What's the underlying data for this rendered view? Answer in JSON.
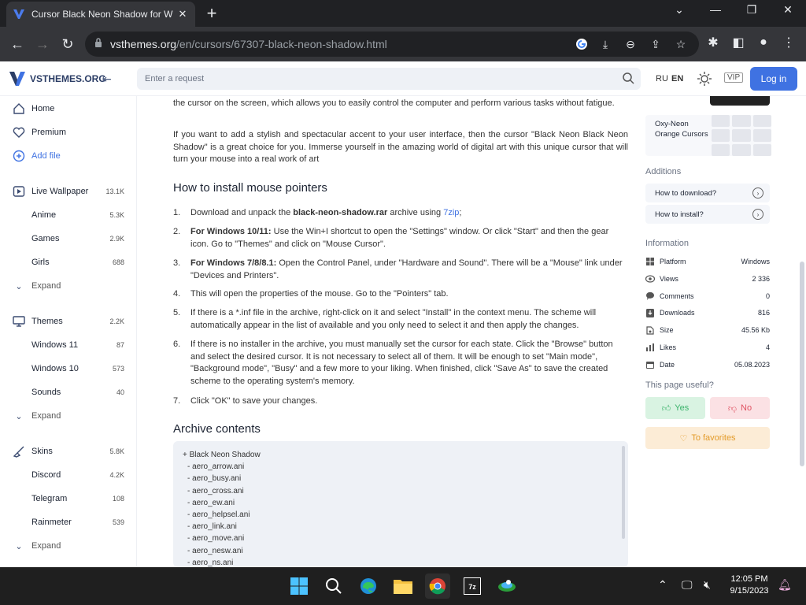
{
  "browser": {
    "tab_title": "Cursor Black Neon Shadow for W",
    "tab_close": "✕",
    "new_tab": "+",
    "url_domain": "vsthemes.org",
    "url_path": "/en/cursors/67307-black-neon-shadow.html",
    "win_minimize": "—",
    "win_restore": "❐",
    "win_close": "✕"
  },
  "site": {
    "logo_text": "VSTHEMES.ORG",
    "search_placeholder": "Enter a request",
    "lang_ru": "RU",
    "lang_en": "EN",
    "vip": "VIP",
    "login": "Log in"
  },
  "sidebar": {
    "home": "Home",
    "premium": "Premium",
    "add_file": "Add file",
    "live_wallpaper": {
      "label": "Live Wallpaper",
      "count": "13.1K"
    },
    "anime": {
      "label": "Anime",
      "count": "5.3K"
    },
    "games": {
      "label": "Games",
      "count": "2.9K"
    },
    "girls": {
      "label": "Girls",
      "count": "688"
    },
    "expand1": "Expand",
    "themes": {
      "label": "Themes",
      "count": "2.2K"
    },
    "windows11": {
      "label": "Windows 11",
      "count": "87"
    },
    "windows10": {
      "label": "Windows 10",
      "count": "573"
    },
    "sounds": {
      "label": "Sounds",
      "count": "40"
    },
    "expand2": "Expand",
    "skins": {
      "label": "Skins",
      "count": "5.8K"
    },
    "discord": {
      "label": "Discord",
      "count": "4.2K"
    },
    "telegram": {
      "label": "Telegram",
      "count": "108"
    },
    "rainmeter": {
      "label": "Rainmeter",
      "count": "539"
    },
    "expand3": "Expand"
  },
  "content": {
    "intro_tail": "the cursor on the screen, which allows you to easily control the computer and perform various tasks without fatigue.",
    "accent_para": "If you want to add a stylish and spectacular accent to your user interface, then the cursor \"Black Neon Black Neon Shadow\" is a great choice for you. Immerse yourself in the amazing world of digital art with this unique cursor that will turn your mouse into a real work of art",
    "install_heading": "How to install mouse pointers",
    "steps": [
      {
        "num": "1.",
        "pre": "Download and unpack the ",
        "bold": "black-neon-shadow.rar",
        "mid": " archive using ",
        "link": "7zip",
        "post": ";"
      },
      {
        "num": "2.",
        "bold": "For Windows 10/11:",
        "text": " Use the Win+I shortcut to open the \"Settings\" window. Or click \"Start\" and then the gear icon. Go to \"Themes\" and click on \"Mouse Cursor\"."
      },
      {
        "num": "3.",
        "bold": "For Windows 7/8/8.1:",
        "text": " Open the Control Panel, under \"Hardware and Sound\". There will be a \"Mouse\" link under \"Devices and Printers\"."
      },
      {
        "num": "4.",
        "text": "This will open the properties of the mouse. Go to the \"Pointers\" tab."
      },
      {
        "num": "5.",
        "text": "If there is a *.inf file in the archive, right-click on it and select \"Install\" in the context menu. The scheme will automatically appear in the list of available and you only need to select it and then apply the changes."
      },
      {
        "num": "6.",
        "text": "If there is no installer in the archive, you must manually set the cursor for each state. Click the \"Browse\" button and select the desired cursor. It is not necessary to select all of them. It will be enough to set \"Main mode\", \"Background mode\", \"Busy\" and a few more to your liking. When finished, click \"Save As\" to save the created scheme to the operating system's memory."
      },
      {
        "num": "7.",
        "text": "Click \"OK\" to save your changes."
      }
    ],
    "archive_heading": "Archive contents",
    "archive_lines": [
      "+ Black Neon Shadow",
      "  - aero_arrow.ani",
      "  - aero_busy.ani",
      "  - aero_cross.ani",
      "  - aero_ew.ani",
      "  - aero_helpsel.ani",
      "  - aero_link.ani",
      "  - aero_move.ani",
      "  - aero_nesw.ani",
      "  - aero_ns.ani"
    ]
  },
  "right": {
    "oxy_name": "Oxy-Neon Orange Cursors",
    "additions_title": "Additions",
    "how_download": "How to download?",
    "how_install": "How to install?",
    "information_title": "Information",
    "info": [
      {
        "label": "Platform",
        "value": "Windows",
        "icon": "windows-icon"
      },
      {
        "label": "Views",
        "value": "2 336",
        "icon": "eye-icon"
      },
      {
        "label": "Comments",
        "value": "0",
        "icon": "comment-icon"
      },
      {
        "label": "Downloads",
        "value": "816",
        "icon": "download-icon"
      },
      {
        "label": "Size",
        "value": "45.56 Kb",
        "icon": "size-icon"
      },
      {
        "label": "Likes",
        "value": "4",
        "icon": "likes-icon"
      },
      {
        "label": "Date",
        "value": "05.08.2023",
        "icon": "calendar-icon"
      }
    ],
    "useful_title": "This page useful?",
    "yes": "Yes",
    "no": "No",
    "favorites": "To favorites"
  },
  "taskbar": {
    "time": "12:05 PM",
    "date": "9/15/2023"
  },
  "colors": {
    "accent": "#3f72e2",
    "yes_bg": "#d9f3e2",
    "no_bg": "#fbe1e4",
    "fav_bg": "#fcecd6"
  }
}
